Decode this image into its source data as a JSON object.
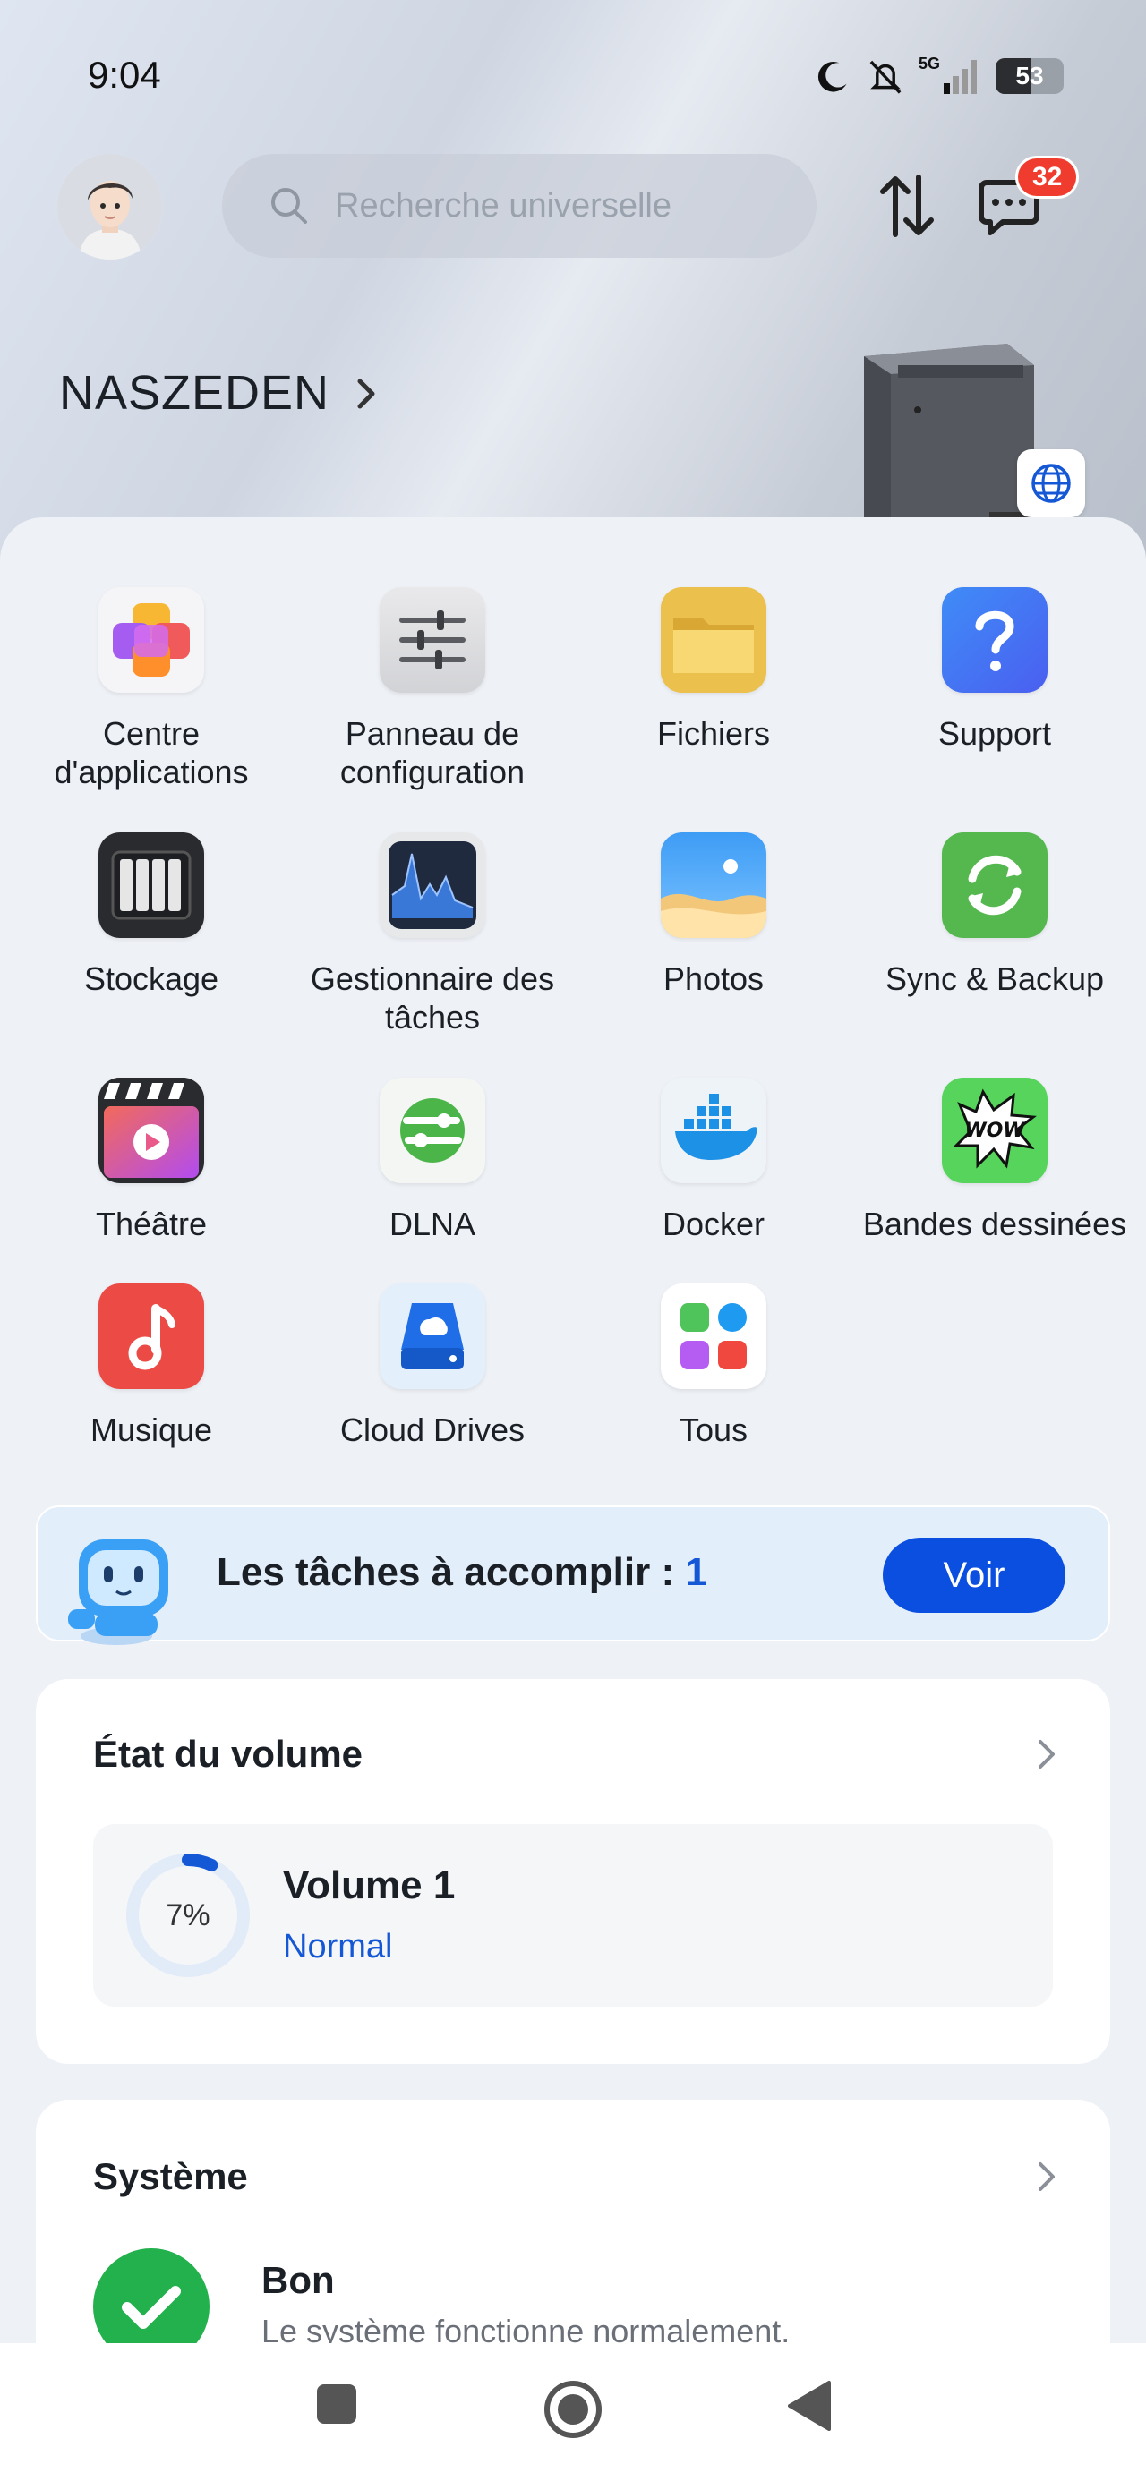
{
  "status_bar": {
    "time": "9:04",
    "network": "5G",
    "battery": "53",
    "battery_level": 0.53
  },
  "top_bar": {
    "search_placeholder": "Recherche universelle",
    "message_badge": "32"
  },
  "device": {
    "name": "NASZEDEN"
  },
  "apps": [
    {
      "label": "Centre d'applications",
      "icon": "app-center-icon"
    },
    {
      "label": "Panneau de configuration",
      "icon": "settings-panel-icon"
    },
    {
      "label": "Fichiers",
      "icon": "folder-icon"
    },
    {
      "label": "Support",
      "icon": "help-icon"
    },
    {
      "label": "Stockage",
      "icon": "storage-icon"
    },
    {
      "label": "Gestionnaire des tâches",
      "icon": "task-manager-icon"
    },
    {
      "label": "Photos",
      "icon": "photos-icon"
    },
    {
      "label": "Sync & Backup",
      "icon": "sync-icon"
    },
    {
      "label": "Théâtre",
      "icon": "theater-icon"
    },
    {
      "label": "DLNA",
      "icon": "dlna-icon"
    },
    {
      "label": "Docker",
      "icon": "docker-icon"
    },
    {
      "label": "Bandes dessinées",
      "icon": "comics-icon"
    },
    {
      "label": "Musique",
      "icon": "music-icon"
    },
    {
      "label": "Cloud Drives",
      "icon": "cloud-drives-icon"
    },
    {
      "label": "Tous",
      "icon": "all-apps-icon"
    }
  ],
  "tasks": {
    "label": "Les tâches à accomplir : ",
    "count": "1",
    "button": "Voir"
  },
  "volume_card": {
    "title": "État du volume",
    "volume_name": "Volume 1",
    "status": "Normal",
    "usage_label": "7%",
    "usage_fraction": 0.07
  },
  "system_card": {
    "title": "Système",
    "status": "Bon",
    "description": "Le système fonctionne normalement."
  },
  "colors": {
    "accent": "#0a4fe0",
    "link": "#1558d6",
    "ok": "#22b14c",
    "badge": "#f03c2e"
  }
}
